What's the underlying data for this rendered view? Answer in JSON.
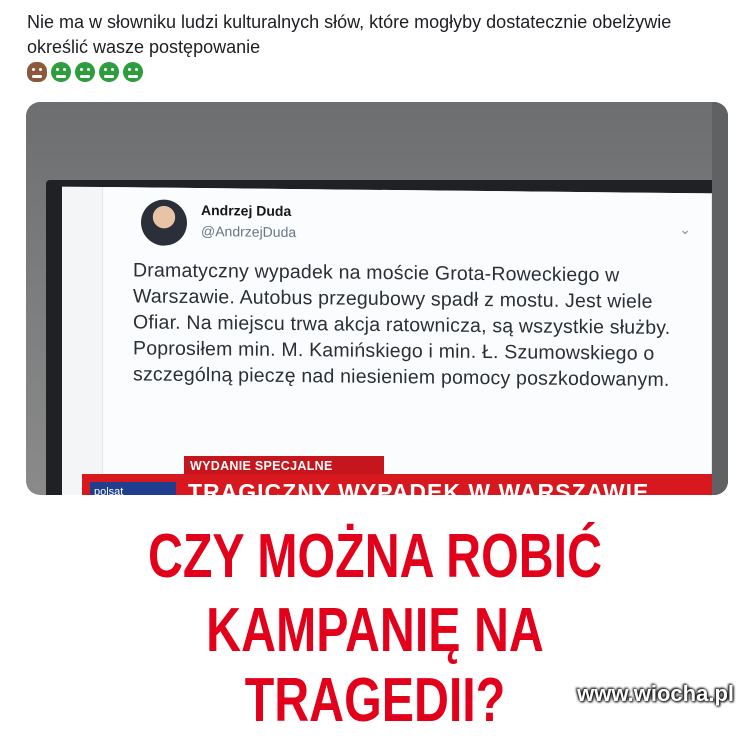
{
  "post": {
    "text": "Nie ma w słowniku ludzi kulturalnych słów, które mogłyby dostatecznie obelżywie określić wasze postępowanie",
    "emojis": [
      "poo-icon",
      "nauseated-face-icon",
      "nauseated-face-icon",
      "nauseated-face-icon",
      "nauseated-face-icon"
    ]
  },
  "tweet": {
    "name": "Andrzej Duda",
    "handle": "@AndrzejDuda",
    "body": "Dramatyczny wypadek na moście Grota-Roweckiego w Warszawie. Autobus przegubowy spadł z mostu. Jest wiele Ofiar. Na miejscu trwa akcja ratownicza, są wszystkie służby. Poprosiłem min. M. Kamińskiego i min. Ł. Szumowskiego o szczególną pieczę nad niesieniem pomocy poszkodowanym."
  },
  "tv": {
    "banner_small": "WYDANIE SPECJALNE",
    "banner_main": "TRAGICZNY WYPADEK W WARSZAWIE",
    "logo": "polsat"
  },
  "headline": {
    "line1": "CZY MOŻNA ROBIĆ",
    "line2": "KAMPANIĘ NA TRAGEDII?"
  },
  "watermark": "www.wiocha.pl",
  "colors": {
    "headline": "#e3001b",
    "ticker": "#d7191f"
  }
}
